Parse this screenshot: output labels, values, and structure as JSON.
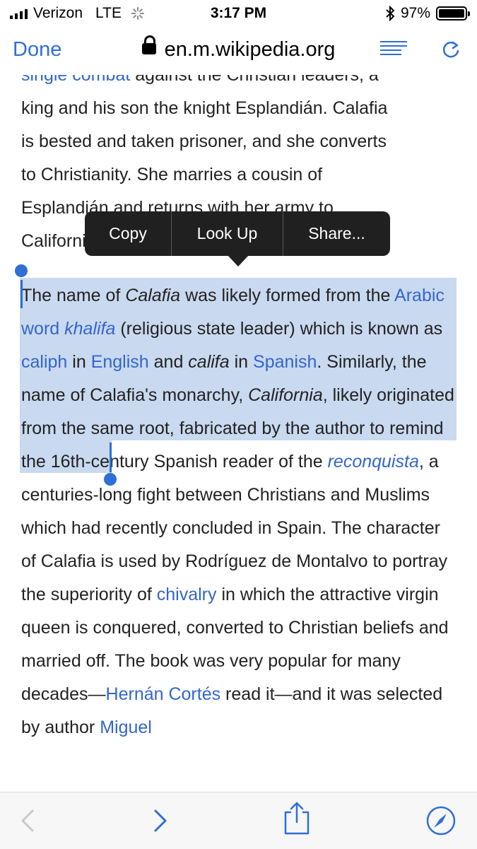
{
  "status_bar": {
    "carrier": "Verizon",
    "network": "LTE",
    "time": "3:17 PM",
    "battery_percent": "97%",
    "battery_level": 0.97
  },
  "browser": {
    "done_label": "Done",
    "url": "en.m.wikipedia.org"
  },
  "article": {
    "para1": {
      "lines": [
        {
          "link": "single combat",
          "text": " against the Christian leaders, a"
        },
        {
          "text": "king and his son the knight Esplandián. Calafia"
        },
        {
          "text": "is bested and taken prisoner, and she converts"
        },
        {
          "text": "to Christianity. She marries a cousin of"
        },
        {
          "text": "Esplandián and returns with her army to"
        },
        {
          "text": "California."
        }
      ]
    },
    "para2": {
      "seg1": "The name of ",
      "calafia_italic": "Calafia",
      "seg2": " was likely formed from the",
      "link_arabic_word": "Arabic word ",
      "link_khalifa": "khalifa",
      "seg3": " (religious state leader) which is known as ",
      "link_caliph": "caliph",
      "seg4": " in ",
      "link_english": "English",
      "seg5": " and ",
      "califa_italic": "califa",
      "seg6": " in ",
      "link_spanish": "Spanish",
      "seg7": ". Similarly, the name of Calafia's monarchy, ",
      "california_italic": "California",
      "seg8": ", likely originated from the same root, fabricated by the author to remind the 16th-century Spanish reader of the ",
      "link_reconquista": "reconquista",
      "seg9": ", a centuries-long fight between Christians and Muslims which had recently concluded in Spain. The character of Calafia is used by Rodríguez de Montalvo to portray the superiority of ",
      "link_chivalry": "chivalry",
      "seg10": " in which the attractive virgin queen is conquered, converted to Christian beliefs and married off. The book was very popular for many decades—",
      "link_hernan": "Hernán Cortés",
      "seg11": " read it—and it was selected by author ",
      "link_miguel": "Miguel"
    }
  },
  "context_menu": {
    "copy": "Copy",
    "look_up": "Look Up",
    "share": "Share..."
  },
  "colors": {
    "link": "#3366cc",
    "accent": "#2f6fd6",
    "selection": "#c9d9ef",
    "menu_bg": "#202020"
  },
  "toolbar": {
    "icons": [
      "back-icon",
      "forward-icon",
      "share-icon",
      "safari-compass-icon"
    ]
  }
}
